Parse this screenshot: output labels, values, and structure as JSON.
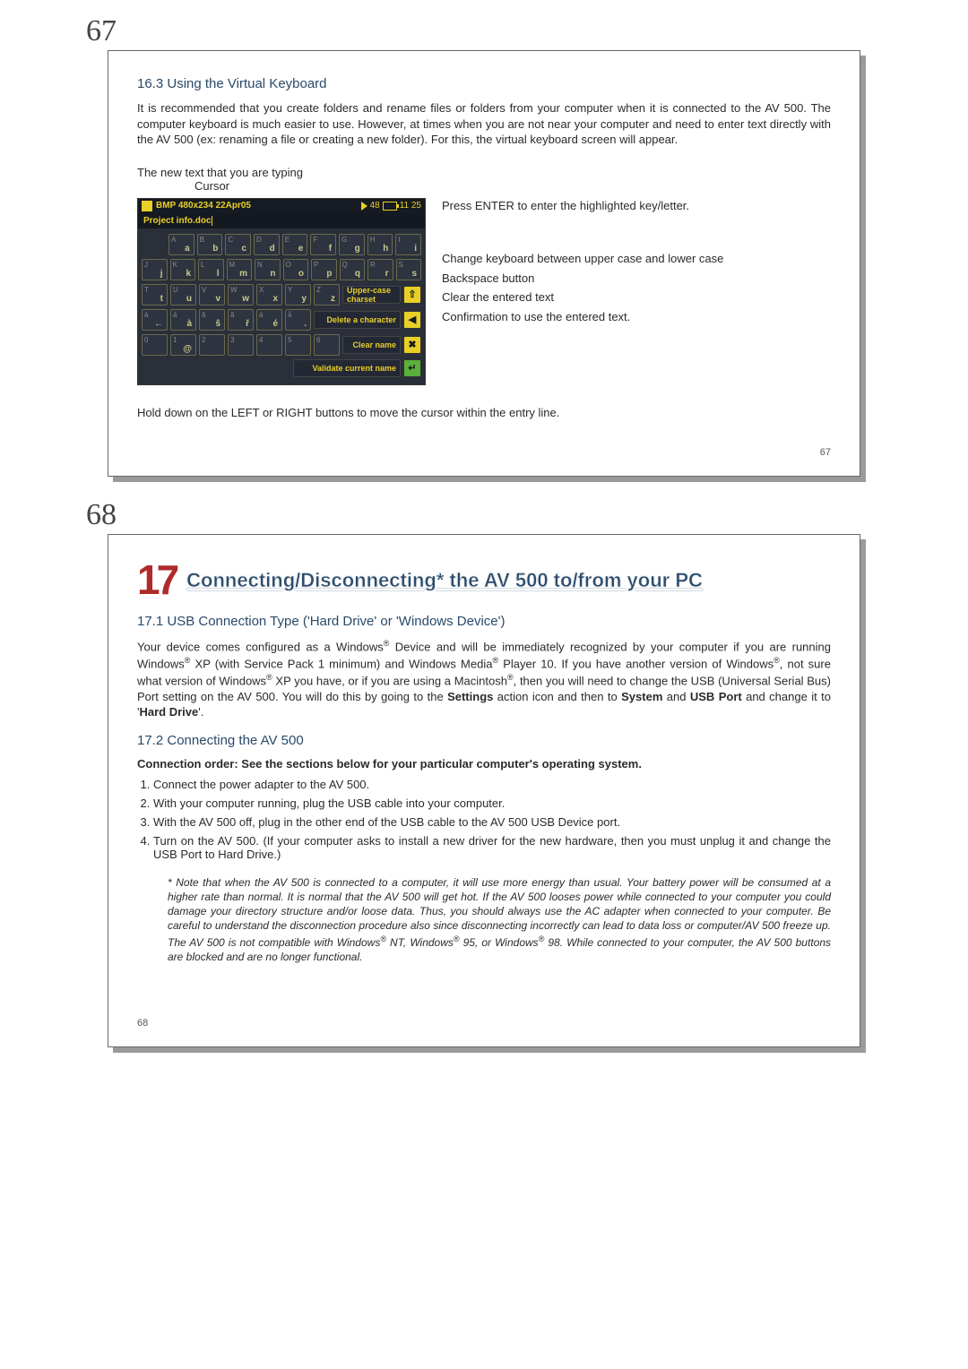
{
  "page67": {
    "outer_num": "67",
    "section_title": "16.3   Using the Virtual Keyboard",
    "intro": "It is recommended that you create folders and rename files or folders from your computer when it is connected to the AV 500. The computer keyboard is much easier to use. However, at times when you are not near your computer and need to enter text directly with the AV 500 (ex: renaming a file or creating a new folder). For this, the virtual keyboard screen will appear.",
    "label_typing": "The new text that you are typing",
    "label_cursor": "Cursor",
    "vk_title": "BMP 480x234 22Apr05",
    "vk_stat_vol": "48",
    "vk_stat_time": "11 25",
    "vk_filename": "Project info.doc",
    "vk_row1_sup": [
      "A",
      "B",
      "C",
      "D",
      "E",
      "F",
      "G",
      "H",
      "I"
    ],
    "vk_row1_main": [
      "a",
      "b",
      "c",
      "d",
      "e",
      "f",
      "g",
      "h",
      "i"
    ],
    "vk_row2_sup": [
      "J",
      "K",
      "L",
      "M",
      "N",
      "O",
      "P",
      "Q",
      "R",
      "S"
    ],
    "vk_row2_main": [
      "j",
      "k",
      "l",
      "m",
      "n",
      "o",
      "p",
      "q",
      "r",
      "s"
    ],
    "vk_row3_sup": [
      "T",
      "U",
      "V",
      "W",
      "X",
      "Y",
      "Z"
    ],
    "vk_row3_main": [
      "t",
      "u",
      "v",
      "w",
      "x",
      "y",
      "z"
    ],
    "vk_row4_sup": [
      "à",
      "á",
      "â",
      "ã",
      "ä",
      "å"
    ],
    "vk_row4_main": [
      "←",
      "à",
      "ŝ",
      "ř",
      "é",
      ".",
      "→"
    ],
    "vk_row5_sup": [
      "0",
      "1",
      "2",
      "3",
      "4",
      "5",
      "6"
    ],
    "vk_row5_main": [
      "",
      "@",
      "",
      "",
      "",
      "",
      ""
    ],
    "vk_action_upper": "Upper-case charset",
    "vk_action_delete": "Delete a character",
    "vk_action_clear": "Clear name",
    "vk_action_validate": "Validate current name",
    "side_enter": "Press ENTER to enter the highlighted key/letter.",
    "side_case": "Change keyboard between upper case and lower case",
    "side_back": "Backspace button",
    "side_clear": "Clear the entered text",
    "side_validate": "Confirmation to use the entered text.",
    "bottom_hint": "Hold down on the LEFT or RIGHT buttons to move the cursor within the entry line.",
    "inner_num": "67"
  },
  "page68": {
    "outer_num": "68",
    "chapter_num": "17",
    "chapter_title": "Connecting/Disconnecting* the AV 500 to/from your PC",
    "sec171_title": "17.1   USB Connection Type ('Hard Drive' or 'Windows Device')",
    "sec171_body_a": "Your device comes configured as a Windows",
    "sec171_body_b": " Device and will be immediately recognized by your computer if you are running Windows",
    "sec171_body_c": " XP (with Service Pack 1 minimum) and Windows Media",
    "sec171_body_d": " Player 10. If you have another version of Windows",
    "sec171_body_e": ", not sure what version of Windows",
    "sec171_body_f": " XP you have, or if you are using a Macintosh",
    "sec171_body_g": ", then you will need to change the USB (Universal Serial Bus) Port setting on the AV 500. You will do this by going to the ",
    "sec171_settings": "Settings",
    "sec171_body_h": " action icon and then to ",
    "sec171_system": "System",
    "sec171_body_i": " and ",
    "sec171_usbport": "USB Port",
    "sec171_body_j": " and change it to '",
    "sec171_harddrive": "Hard Drive",
    "sec171_body_k": "'.",
    "sec172_title": "17.2   Connecting the AV 500",
    "sec172_order": "Connection order: See the sections below for your particular computer's operating system.",
    "step1": "Connect the power adapter to the AV 500.",
    "step2": "With your computer running, plug the USB cable into your computer.",
    "step3": "With the AV 500 off, plug in the other end of the USB cable to the AV 500 USB Device port.",
    "step4": "Turn on the AV 500. (If your computer asks to install a new driver for the new hardware, then you must unplug it and change the USB Port to Hard Drive.)",
    "footnote_a": "* Note that when the AV 500 is connected to a computer, it will use more energy than usual. Your battery power will be consumed at a higher rate than normal. It is normal that the AV 500 will get hot. If the AV 500 looses power while connected to your computer you could damage your directory structure and/or loose data. Thus, you should always use the AC adapter when connected to your computer. Be careful to understand the disconnection procedure also since disconnecting incorrectly can lead to data loss or computer/AV 500 freeze up. The AV 500 is not compatible with Windows",
    "footnote_b": " NT, Windows",
    "footnote_c": " 95, or Windows",
    "footnote_d": " 98. While connected to your computer, the AV 500 buttons are blocked and are no longer functional.",
    "inner_num": "68"
  }
}
